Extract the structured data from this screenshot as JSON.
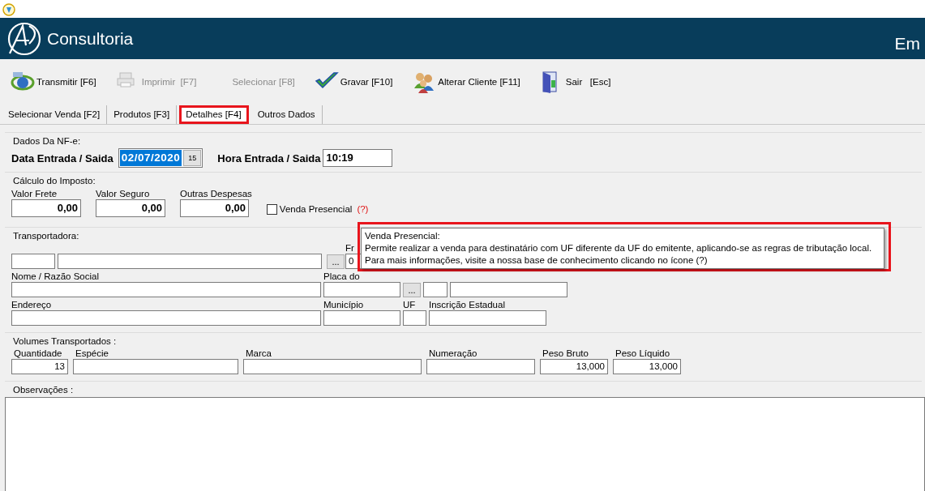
{
  "window": {
    "brand": "Consultoria",
    "title": "Em"
  },
  "toolbar": [
    {
      "kind": "nfe",
      "label": "Transmitir [F6]",
      "disabled": false
    },
    {
      "kind": "printer",
      "label": "Imprimir  [F7]",
      "disabled": true
    },
    {
      "kind": "none",
      "label": "Selecionar [F8]",
      "disabled": true
    },
    {
      "kind": "check",
      "label": "Gravar [F10]",
      "disabled": false
    },
    {
      "kind": "users",
      "label": "Alterar Cliente [F11]",
      "disabled": false
    },
    {
      "kind": "exit",
      "label": "Sair   [Esc]",
      "disabled": false
    }
  ],
  "tabs": [
    {
      "label": "Selecionar Venda [F2]",
      "selected": false
    },
    {
      "label": "Produtos [F3]",
      "selected": false
    },
    {
      "label": "Detalhes [F4]",
      "selected": true
    },
    {
      "label": "Outros Dados",
      "selected": false
    }
  ],
  "dados_nfe": {
    "legend": "Dados Da NF-e:",
    "data_label": "Data Entrada / Saida",
    "data_value": "02/07/2020",
    "calendar_button": "15",
    "hora_label": "Hora Entrada / Saida",
    "hora_value": "10:19"
  },
  "calculo_imposto": {
    "legend": "Cálculo do Imposto:",
    "fields": [
      {
        "label": "Valor Frete",
        "value": "0,00"
      },
      {
        "label": "Valor Seguro",
        "value": "0,00"
      },
      {
        "label": "Outras Despesas",
        "value": "0,00"
      }
    ],
    "venda_presencial": {
      "label": "Venda Presencial",
      "checked": false,
      "help": "(?)"
    }
  },
  "transportadora": {
    "legend": "Transportadora:",
    "browse_button": "...",
    "frete_label": "Fr",
    "frete_value": "0",
    "nome_label": "Nome / Razão Social",
    "placa_label": "Placa do",
    "placa_button": "...",
    "endereco_label": "Endereço",
    "municipio_label": "Município",
    "uf_label": "UF",
    "ie_label": "Inscrição Estadual"
  },
  "volumes": {
    "legend": "Volumes Transportados :",
    "fields": [
      {
        "label": "Quantidade",
        "value": "13"
      },
      {
        "label": "Espécie"
      },
      {
        "label": "Marca"
      },
      {
        "label": "Numeração"
      },
      {
        "label": "Peso Bruto",
        "value": "13,000"
      },
      {
        "label": "Peso Líquido",
        "value": "13,000"
      }
    ]
  },
  "observacoes": {
    "legend": "Observações :"
  },
  "tooltip": {
    "title": "Venda Presencial:",
    "lines": [
      "Permite realizar a venda para destinatário com UF diferente da UF do emitente, aplicando-se as regras de tributação local.",
      "Para mais informações, visite a nossa base de conhecimento clicando no ícone (?)"
    ]
  }
}
